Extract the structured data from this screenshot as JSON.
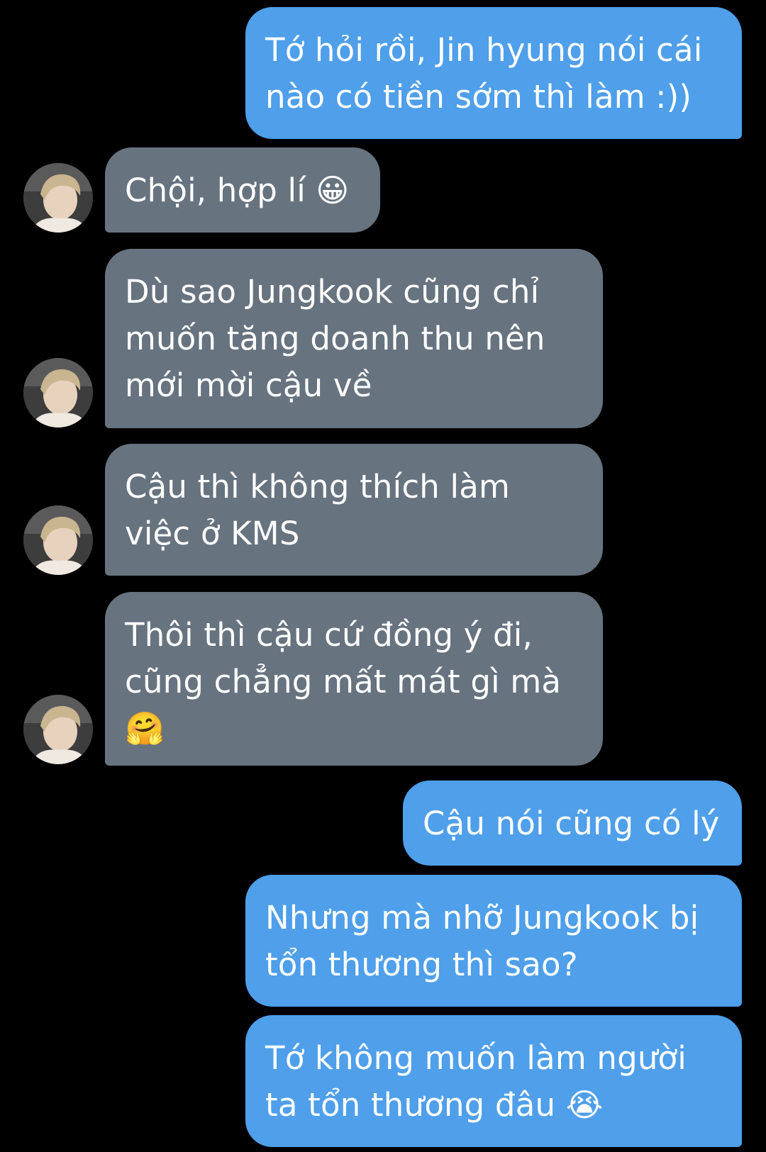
{
  "messages": [
    {
      "side": "sent",
      "text": "Tớ hỏi rồi, Jin hyung nói cái\nnào có tiền sớm thì làm :))"
    },
    {
      "side": "received",
      "text": "Chội, hợp lí 😀"
    },
    {
      "side": "received",
      "text": "Dù sao Jungkook cũng chỉ\nmuốn tăng doanh thu nên\nmới mời cậu về"
    },
    {
      "side": "received",
      "text": "Cậu thì không thích làm\nviệc ở KMS"
    },
    {
      "side": "received",
      "text": "Thôi thì cậu cứ đồng ý đi,\ncũng chẳng mất mát gì mà\n🤗"
    },
    {
      "side": "sent",
      "text": "Cậu nói cũng có lý"
    },
    {
      "side": "sent",
      "text": "Nhưng mà nhỡ Jungkook bị\ntổn thương thì sao?"
    },
    {
      "side": "sent",
      "text": "Tớ không muốn làm người\nta tổn thương đâu 😭"
    }
  ],
  "colors": {
    "background": "#000000",
    "sent_bubble": "#4f9fea",
    "received_bubble": "#67737f",
    "text": "#ffffff"
  },
  "icons": {
    "avatar": "contact-avatar-photo"
  }
}
